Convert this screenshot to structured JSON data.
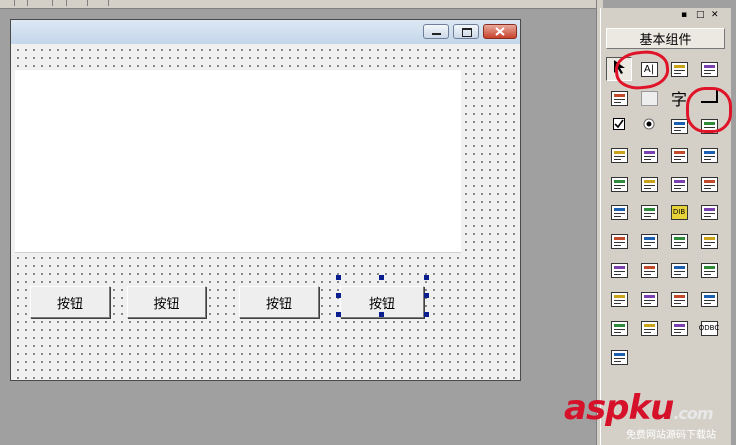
{
  "form": {
    "buttons": [
      {
        "label": "按钮"
      },
      {
        "label": "按钮"
      },
      {
        "label": "按钮"
      },
      {
        "label": "按钮",
        "selected": true
      }
    ]
  },
  "toolbox": {
    "tab_label": "基本组件",
    "header_icons": [
      "pin-icon",
      "restore-icon",
      "close-icon"
    ],
    "tools": [
      {
        "name": "pointer-icon",
        "selected": true
      },
      {
        "name": "label-tool-icon",
        "text": "A|"
      },
      {
        "name": "picture-tool-icon"
      },
      {
        "name": "shape-tool-icon"
      },
      {
        "name": "edit-tool-icon"
      },
      {
        "name": "blank-tool-icon"
      },
      {
        "name": "text-tool-icon",
        "text": "字"
      },
      {
        "name": "button-tool-icon"
      },
      {
        "name": "checkbox-tool-icon"
      },
      {
        "name": "radio-tool-icon"
      },
      {
        "name": "listview-tool-icon"
      },
      {
        "name": "tab-tool-icon"
      },
      {
        "name": "grid-tool-icon"
      },
      {
        "name": "spin-tool-icon"
      },
      {
        "name": "slider-tool-icon"
      },
      {
        "name": "ruler-tool-icon"
      },
      {
        "name": "hscroll-tool-icon"
      },
      {
        "name": "tabstrip-tool-icon"
      },
      {
        "name": "chart-tool-icon"
      },
      {
        "name": "gauge-tool-icon"
      },
      {
        "name": "table-tool-icon"
      },
      {
        "name": "ime-tool-icon"
      },
      {
        "name": "dib-tool-icon",
        "text": "DIB"
      },
      {
        "name": "document-tool-icon"
      },
      {
        "name": "palette-tool-icon"
      },
      {
        "name": "globe-tool-icon"
      },
      {
        "name": "split-tool-icon"
      },
      {
        "name": "monitor-tool-icon"
      },
      {
        "name": "timer-tool-icon"
      },
      {
        "name": "printer-tool-icon"
      },
      {
        "name": "transfer-tool-icon"
      },
      {
        "name": "network-tool-icon"
      },
      {
        "name": "computer-tool-icon"
      },
      {
        "name": "link-tool-icon"
      },
      {
        "name": "window-tool-icon"
      },
      {
        "name": "database-grid-tool-icon"
      },
      {
        "name": "tree-tool-icon"
      },
      {
        "name": "db-list-tool-icon"
      },
      {
        "name": "area-chart-tool-icon"
      },
      {
        "name": "odbc-tool-icon",
        "text": "ODBC"
      },
      {
        "name": "plug-tool-icon"
      }
    ]
  },
  "annotation_color": "#e01428",
  "watermark": {
    "main": "aspku",
    "tld": ".com",
    "sub": "免费网站源码下载站"
  }
}
